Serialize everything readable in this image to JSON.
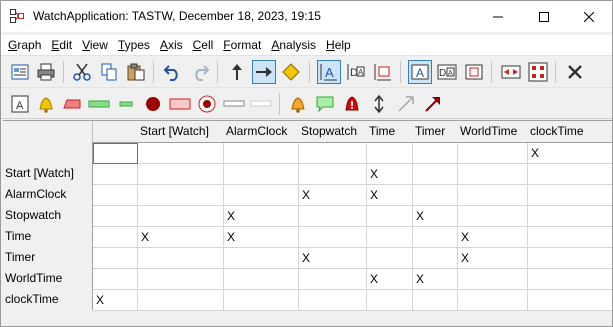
{
  "window": {
    "title": "WatchApplication: TASTW, December 18, 2023, 19:15"
  },
  "menu": [
    "Graph",
    "Edit",
    "View",
    "Types",
    "Axis",
    "Cell",
    "Format",
    "Analysis",
    "Help"
  ],
  "menu_underline": [
    "G",
    "E",
    "V",
    "T",
    "A",
    "C",
    "F",
    "A",
    "H"
  ],
  "toolbar1": {
    "icons": [
      "report-icon",
      "print-icon",
      "cut-icon",
      "copy-icon",
      "paste-icon",
      "undo-icon",
      "redo-icon",
      "arrow-up-icon",
      "arrow-right-icon",
      "diamond-icon",
      "text-a-icon",
      "text-box-a-icon",
      "text-box-icon",
      "frame-a-icon",
      "frame-aa-icon",
      "frame-icon",
      "expand-horizontal-icon",
      "expand-grid-icon",
      "delete-icon"
    ]
  },
  "toolbar2": {
    "icons": [
      "text-node-icon",
      "bell-icon",
      "red-box-icon",
      "green-bar-icon",
      "green-small-bar-icon",
      "red-circle-icon",
      "pink-box-icon",
      "record-icon",
      "gray-bar-icon",
      "light-gray-bar-icon",
      "orange-bell-icon",
      "green-speech-icon",
      "alarm-warning-icon",
      "vertical-arrows-icon",
      "diagonal-arrow-gray-icon",
      "diagonal-arrow-red-icon"
    ]
  },
  "grid": {
    "columns": [
      "Start [Watch]",
      "AlarmClock",
      "Stopwatch",
      "Time",
      "Timer",
      "WorldTime",
      "clockTime"
    ],
    "rows": [
      "Start [Watch]",
      "AlarmClock",
      "Stopwatch",
      "Time",
      "Timer",
      "WorldTime",
      "clockTime"
    ],
    "top_row": [
      "",
      "",
      "",
      "",
      "",
      "",
      "",
      "X"
    ],
    "cells": [
      [
        "",
        "",
        "",
        "",
        "X",
        "",
        "",
        ""
      ],
      [
        "",
        "",
        "",
        "X",
        "X",
        "",
        "",
        ""
      ],
      [
        "",
        "",
        "X",
        "",
        "",
        "X",
        "",
        ""
      ],
      [
        "",
        "X",
        "X",
        "",
        "",
        "",
        "X",
        ""
      ],
      [
        "",
        "",
        "",
        "X",
        "",
        "",
        "X",
        ""
      ],
      [
        "",
        "",
        "",
        "",
        "X",
        "X",
        "",
        ""
      ],
      [
        "X",
        "",
        "",
        "",
        "",
        "",
        "",
        ""
      ]
    ]
  },
  "colors": {
    "accent": "#3c7fb1",
    "alarm_red": "#cc0000",
    "bell_orange": "#f5a623",
    "green": "#66cc66"
  }
}
